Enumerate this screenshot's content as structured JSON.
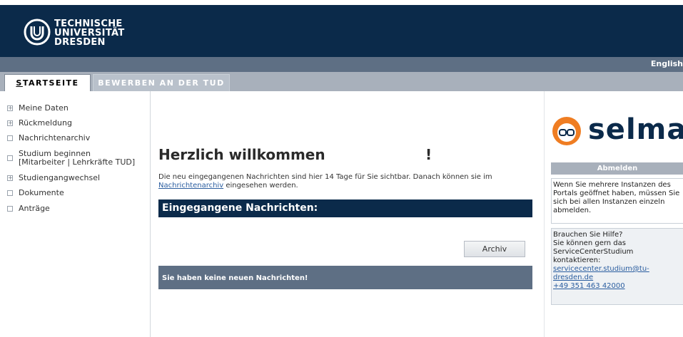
{
  "header": {
    "logo_lines": [
      "TECHNISCHE",
      "UNIVERSITÄT",
      "DRESDEN"
    ],
    "language_link": "English"
  },
  "tabs": [
    {
      "label_first": "S",
      "label_rest": "TARTSEITE",
      "active": true
    },
    {
      "label": "BEWERBEN AN DER TUD",
      "active": false
    }
  ],
  "sidebar": {
    "items": [
      {
        "label": "Meine Daten",
        "icon": "expand-plus-icon"
      },
      {
        "label": "Rückmeldung",
        "icon": "expand-plus-icon"
      },
      {
        "label": "Nachrichtenarchiv",
        "icon": "empty-box-icon"
      },
      {
        "label": "Studium beginnen",
        "label2": "[Mitarbeiter | Lehrkräfte TUD]",
        "icon": "empty-box-icon"
      },
      {
        "label": "Studiengangwechsel",
        "icon": "expand-plus-icon"
      },
      {
        "label": "Dokumente",
        "icon": "empty-box-icon"
      },
      {
        "label": "Anträge",
        "icon": "empty-box-icon"
      }
    ]
  },
  "main": {
    "welcome_title": "Herzlich willkommen",
    "welcome_excl": "!",
    "info_text_1": "Die neu eingegangenen Nachrichten sind hier 14 Tage für Sie sichtbar. Danach können sie im",
    "info_link": "Nachrichtenarchiv",
    "info_text_2": " eingesehen werden.",
    "inbox_heading": "Eingegangene Nachrichten:",
    "archive_button": "Archiv",
    "no_messages": "Sie haben keine neuen Nachrichten!"
  },
  "right": {
    "brand": "selma",
    "logout_label": "Abmelden",
    "note_instances": "Wenn Sie mehrere Instanzen des Portals geöffnet haben, müssen Sie sich bei allen Instanzen einzeln abmelden.",
    "help_line1": "Brauchen Sie Hilfe?",
    "help_line2": "Sie können gern das ServiceCenterStudium kontaktieren:",
    "help_email": "servicecenter.studium@tu-dresden.de",
    "help_phone": "+49 351 463 42000"
  },
  "colors": {
    "header_navy": "#0b2a4a",
    "bar_slate": "#5e6f84",
    "tab_gray": "#a8b0bb",
    "link_blue": "#2a5d9f",
    "selma_orange": "#ef7d22"
  }
}
